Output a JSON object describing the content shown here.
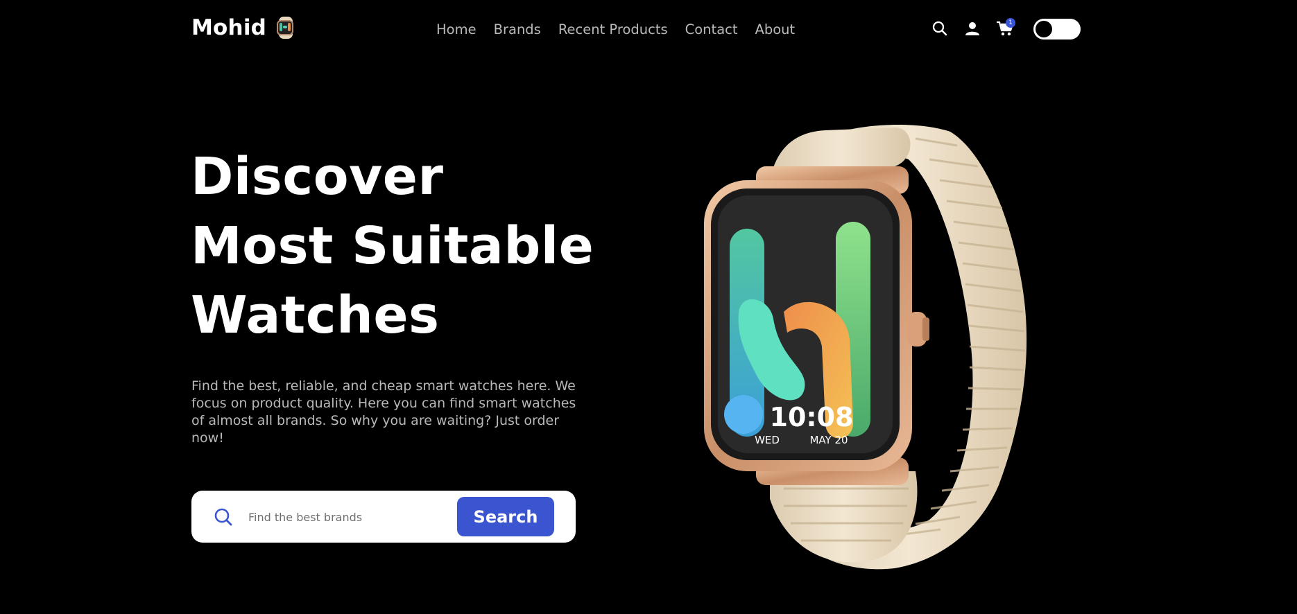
{
  "brand": {
    "name": "Mohid",
    "logo_icon": "watch-logo-icon"
  },
  "nav": {
    "links": [
      "Home",
      "Brands",
      "Recent Products",
      "Contact",
      "About"
    ]
  },
  "header_icons": {
    "search_icon": "search-icon",
    "user_icon": "user-icon",
    "cart_icon": "cart-icon",
    "cart_count": "1",
    "theme_toggle_state": "off"
  },
  "hero": {
    "title_lines": [
      "Discover",
      "Most Suitable",
      "Watches"
    ],
    "description": "Find the best, reliable, and cheap smart watches here. We focus on product quality. Here you can find smart watches of almost all brands. So why you are waiting? Just order now!",
    "search": {
      "placeholder": "Find the best brands",
      "value": "",
      "button_label": "Search"
    }
  },
  "product_image": {
    "time": "10:08",
    "day": "WED",
    "date": "MAY 20"
  },
  "colors": {
    "background": "#000000",
    "accent": "#3b55d0",
    "nav_text": "#b9b9b9",
    "strap": "#efe1c8",
    "case": "#d8a784"
  }
}
